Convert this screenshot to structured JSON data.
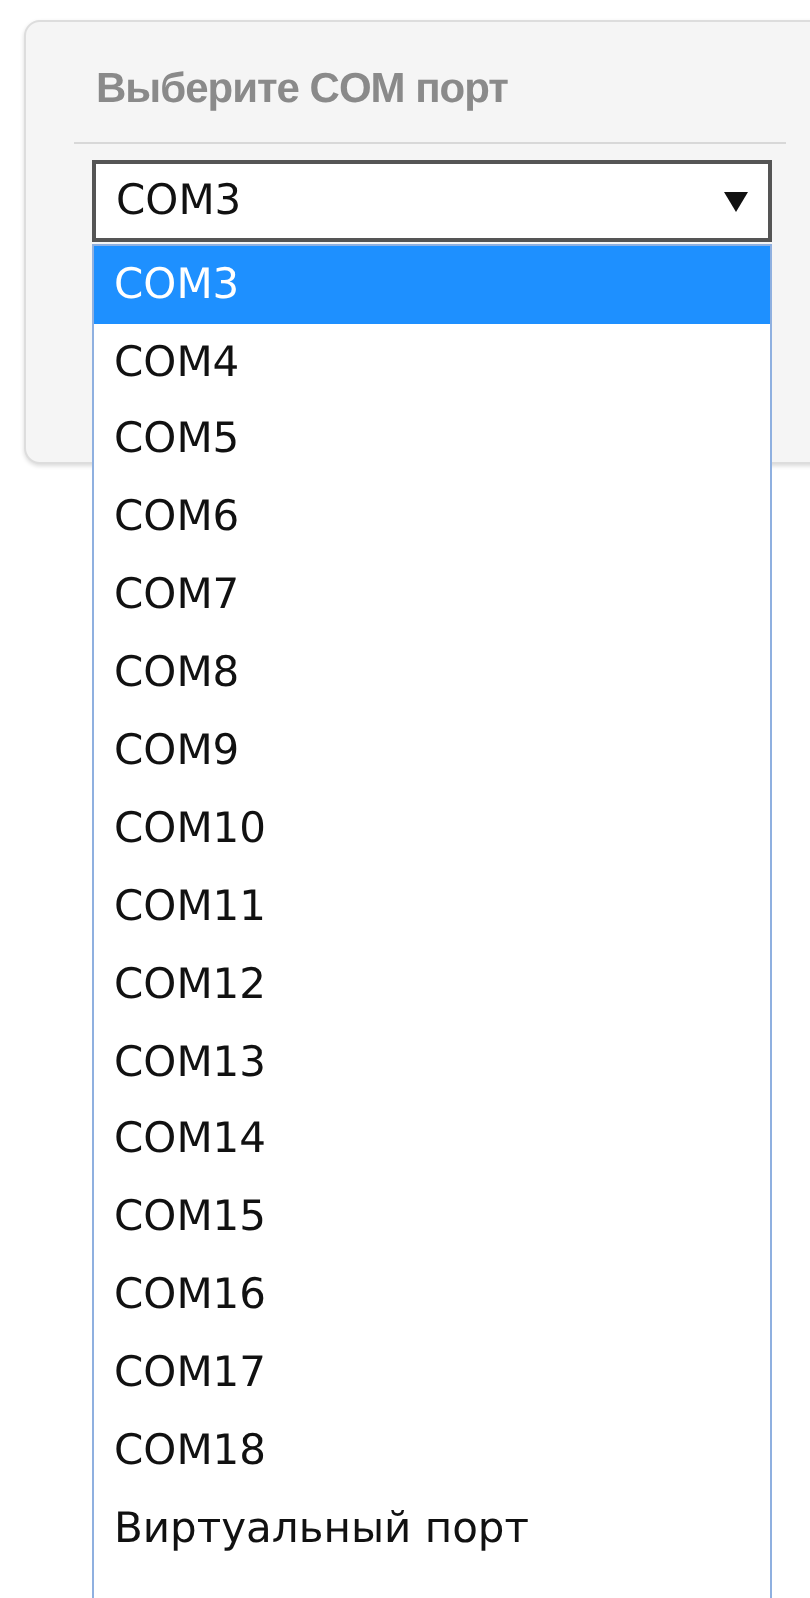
{
  "panel": {
    "title": "Выберите COM порт"
  },
  "select": {
    "value": "COM3",
    "expanded": true,
    "options": [
      {
        "label": "COM3",
        "selected": true
      },
      {
        "label": "COM4",
        "selected": false
      },
      {
        "label": "COM5",
        "selected": false
      },
      {
        "label": "COM6",
        "selected": false
      },
      {
        "label": "COM7",
        "selected": false
      },
      {
        "label": "COM8",
        "selected": false
      },
      {
        "label": "COM9",
        "selected": false
      },
      {
        "label": "COM10",
        "selected": false
      },
      {
        "label": "COM11",
        "selected": false
      },
      {
        "label": "COM12",
        "selected": false
      },
      {
        "label": "COM13",
        "selected": false
      },
      {
        "label": "COM14",
        "selected": false
      },
      {
        "label": "COM15",
        "selected": false
      },
      {
        "label": "COM16",
        "selected": false
      },
      {
        "label": "COM17",
        "selected": false
      },
      {
        "label": "COM18",
        "selected": false
      },
      {
        "label": "Виртуальный порт",
        "selected": false
      }
    ]
  }
}
